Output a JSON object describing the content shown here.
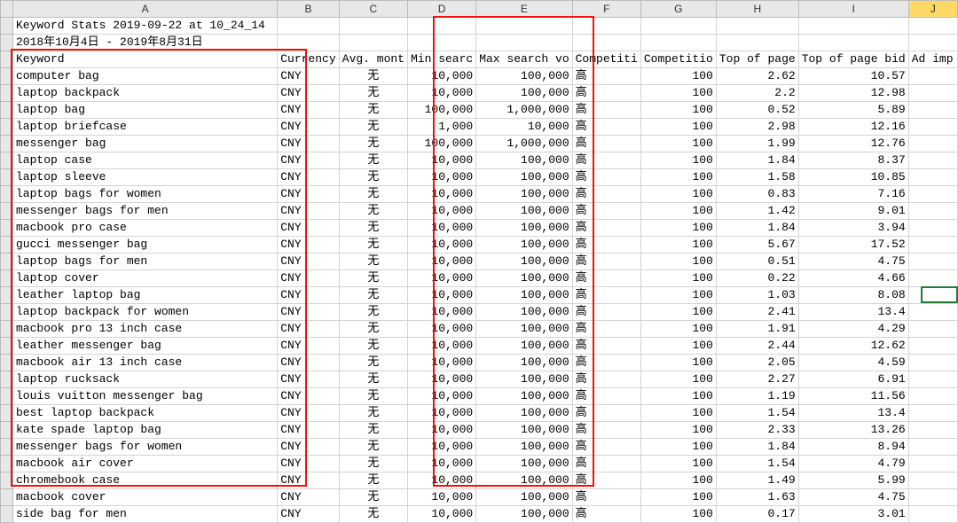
{
  "columns": [
    "A",
    "B",
    "C",
    "D",
    "E",
    "F",
    "G",
    "H",
    "I",
    "J"
  ],
  "selected_col": "J",
  "meta": {
    "title": "Keyword Stats 2019-09-22 at 10_24_14",
    "daterange": "2018年10月4日 - 2019年8月31日"
  },
  "headers": {
    "A": "Keyword",
    "B": "Currency",
    "C": "Avg. mont",
    "D": "Min searc",
    "E": "Max search vo",
    "F": "Competiti",
    "G": "Competitio",
    "H": "Top of page",
    "I": "Top of page bid",
    "J": "Ad imp"
  },
  "rows": [
    {
      "kw": "computer bag",
      "cur": "CNY",
      "avg": "无",
      "min": "10,000",
      "max": "100,000",
      "cmp": "高",
      "ci": "100",
      "tp": "2.62",
      "tph": "10.57"
    },
    {
      "kw": "laptop backpack",
      "cur": "CNY",
      "avg": "无",
      "min": "10,000",
      "max": "100,000",
      "cmp": "高",
      "ci": "100",
      "tp": "2.2",
      "tph": "12.98"
    },
    {
      "kw": "laptop bag",
      "cur": "CNY",
      "avg": "无",
      "min": "100,000",
      "max": "1,000,000",
      "cmp": "高",
      "ci": "100",
      "tp": "0.52",
      "tph": "5.89"
    },
    {
      "kw": "laptop briefcase",
      "cur": "CNY",
      "avg": "无",
      "min": "1,000",
      "max": "10,000",
      "cmp": "高",
      "ci": "100",
      "tp": "2.98",
      "tph": "12.16"
    },
    {
      "kw": "messenger bag",
      "cur": "CNY",
      "avg": "无",
      "min": "100,000",
      "max": "1,000,000",
      "cmp": "高",
      "ci": "100",
      "tp": "1.99",
      "tph": "12.76"
    },
    {
      "kw": "laptop case",
      "cur": "CNY",
      "avg": "无",
      "min": "10,000",
      "max": "100,000",
      "cmp": "高",
      "ci": "100",
      "tp": "1.84",
      "tph": "8.37"
    },
    {
      "kw": "laptop sleeve",
      "cur": "CNY",
      "avg": "无",
      "min": "10,000",
      "max": "100,000",
      "cmp": "高",
      "ci": "100",
      "tp": "1.58",
      "tph": "10.85"
    },
    {
      "kw": "laptop bags for women",
      "cur": "CNY",
      "avg": "无",
      "min": "10,000",
      "max": "100,000",
      "cmp": "高",
      "ci": "100",
      "tp": "0.83",
      "tph": "7.16"
    },
    {
      "kw": "messenger bags for men",
      "cur": "CNY",
      "avg": "无",
      "min": "10,000",
      "max": "100,000",
      "cmp": "高",
      "ci": "100",
      "tp": "1.42",
      "tph": "9.01"
    },
    {
      "kw": "macbook pro case",
      "cur": "CNY",
      "avg": "无",
      "min": "10,000",
      "max": "100,000",
      "cmp": "高",
      "ci": "100",
      "tp": "1.84",
      "tph": "3.94"
    },
    {
      "kw": "gucci messenger bag",
      "cur": "CNY",
      "avg": "无",
      "min": "10,000",
      "max": "100,000",
      "cmp": "高",
      "ci": "100",
      "tp": "5.67",
      "tph": "17.52"
    },
    {
      "kw": "laptop bags for men",
      "cur": "CNY",
      "avg": "无",
      "min": "10,000",
      "max": "100,000",
      "cmp": "高",
      "ci": "100",
      "tp": "0.51",
      "tph": "4.75"
    },
    {
      "kw": "laptop cover",
      "cur": "CNY",
      "avg": "无",
      "min": "10,000",
      "max": "100,000",
      "cmp": "高",
      "ci": "100",
      "tp": "0.22",
      "tph": "4.66"
    },
    {
      "kw": "leather laptop bag",
      "cur": "CNY",
      "avg": "无",
      "min": "10,000",
      "max": "100,000",
      "cmp": "高",
      "ci": "100",
      "tp": "1.03",
      "tph": "8.08"
    },
    {
      "kw": "laptop backpack for women",
      "cur": "CNY",
      "avg": "无",
      "min": "10,000",
      "max": "100,000",
      "cmp": "高",
      "ci": "100",
      "tp": "2.41",
      "tph": "13.4"
    },
    {
      "kw": "macbook pro 13 inch case",
      "cur": "CNY",
      "avg": "无",
      "min": "10,000",
      "max": "100,000",
      "cmp": "高",
      "ci": "100",
      "tp": "1.91",
      "tph": "4.29"
    },
    {
      "kw": "leather messenger bag",
      "cur": "CNY",
      "avg": "无",
      "min": "10,000",
      "max": "100,000",
      "cmp": "高",
      "ci": "100",
      "tp": "2.44",
      "tph": "12.62"
    },
    {
      "kw": "macbook air 13 inch case",
      "cur": "CNY",
      "avg": "无",
      "min": "10,000",
      "max": "100,000",
      "cmp": "高",
      "ci": "100",
      "tp": "2.05",
      "tph": "4.59"
    },
    {
      "kw": "laptop rucksack",
      "cur": "CNY",
      "avg": "无",
      "min": "10,000",
      "max": "100,000",
      "cmp": "高",
      "ci": "100",
      "tp": "2.27",
      "tph": "6.91"
    },
    {
      "kw": "louis vuitton messenger bag",
      "cur": "CNY",
      "avg": "无",
      "min": "10,000",
      "max": "100,000",
      "cmp": "高",
      "ci": "100",
      "tp": "1.19",
      "tph": "11.56"
    },
    {
      "kw": "best laptop backpack",
      "cur": "CNY",
      "avg": "无",
      "min": "10,000",
      "max": "100,000",
      "cmp": "高",
      "ci": "100",
      "tp": "1.54",
      "tph": "13.4"
    },
    {
      "kw": "kate spade laptop bag",
      "cur": "CNY",
      "avg": "无",
      "min": "10,000",
      "max": "100,000",
      "cmp": "高",
      "ci": "100",
      "tp": "2.33",
      "tph": "13.26"
    },
    {
      "kw": "messenger bags for women",
      "cur": "CNY",
      "avg": "无",
      "min": "10,000",
      "max": "100,000",
      "cmp": "高",
      "ci": "100",
      "tp": "1.84",
      "tph": "8.94"
    },
    {
      "kw": "macbook air cover",
      "cur": "CNY",
      "avg": "无",
      "min": "10,000",
      "max": "100,000",
      "cmp": "高",
      "ci": "100",
      "tp": "1.54",
      "tph": "4.79"
    },
    {
      "kw": "chromebook case",
      "cur": "CNY",
      "avg": "无",
      "min": "10,000",
      "max": "100,000",
      "cmp": "高",
      "ci": "100",
      "tp": "1.49",
      "tph": "5.99"
    },
    {
      "kw": "macbook cover",
      "cur": "CNY",
      "avg": "无",
      "min": "10,000",
      "max": "100,000",
      "cmp": "高",
      "ci": "100",
      "tp": "1.63",
      "tph": "4.75"
    },
    {
      "kw": "side bag for men",
      "cur": "CNY",
      "avg": "无",
      "min": "10,000",
      "max": "100,000",
      "cmp": "高",
      "ci": "100",
      "tp": "0.17",
      "tph": "3.01"
    }
  ]
}
